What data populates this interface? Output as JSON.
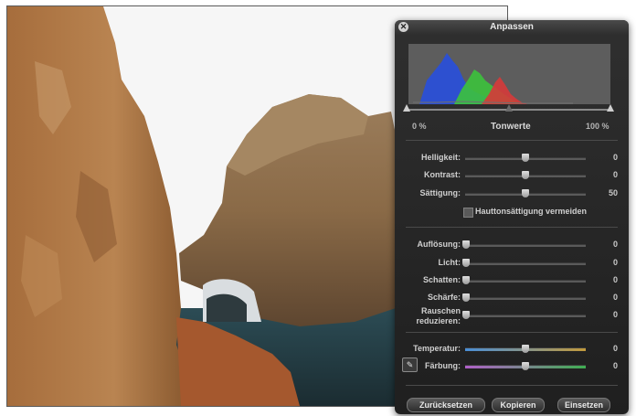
{
  "panel": {
    "title": "Anpassen",
    "close_icon": "close-icon",
    "histogram": {
      "min_label": "0 %",
      "center_label": "Tonwerte",
      "max_label": "100 %",
      "channel_colors": {
        "blue": "#2a4fd6",
        "green": "#3cc23c",
        "red": "#d63a3a"
      }
    },
    "sliders_top": [
      {
        "label": "Helligkeit:",
        "value": "0",
        "level": 0.5
      },
      {
        "label": "Kontrast:",
        "value": "0",
        "level": 0.5
      },
      {
        "label": "Sättigung:",
        "value": "50",
        "level": 0.5
      }
    ],
    "skin_checkbox": {
      "label": "Hauttonsättigung vermeiden",
      "checked": false
    },
    "sliders_detail": [
      {
        "label": "Auflösung:",
        "value": "0",
        "level": 0.0
      },
      {
        "label": "Licht:",
        "value": "0",
        "level": 0.0
      },
      {
        "label": "Schatten:",
        "value": "0",
        "level": 0.0
      },
      {
        "label": "Schärfe:",
        "value": "0",
        "level": 0.0
      },
      {
        "label": "Rauschen",
        "label2": "reduzieren:",
        "value": "0",
        "level": 0.0
      }
    ],
    "sliders_color": [
      {
        "label": "Temperatur:",
        "value": "0",
        "level": 0.5
      },
      {
        "label": "Färbung:",
        "value": "0",
        "level": 0.5
      }
    ],
    "buttons": {
      "reset": "Zurücksetzen",
      "copy": "Kopieren",
      "paste": "Einsetzen"
    }
  }
}
